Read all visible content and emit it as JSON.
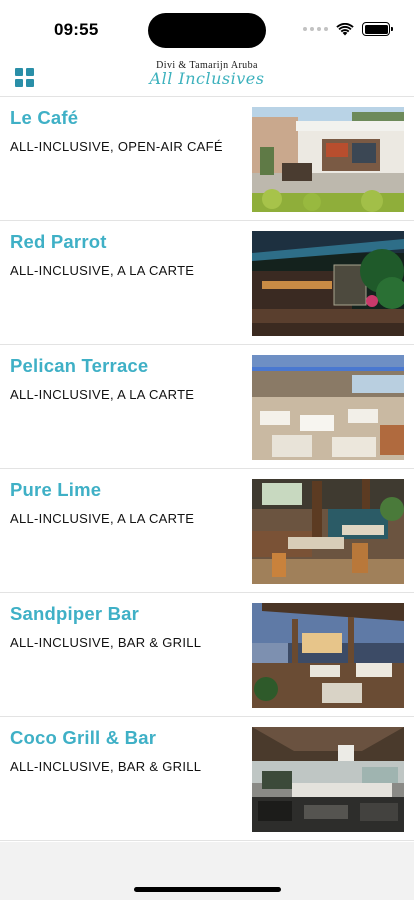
{
  "status_bar": {
    "time": "09:55"
  },
  "header": {
    "logo_top": "Divi & Tamarijn Aruba",
    "logo_script": "All Inclusives",
    "menu_icon": "grid-icon",
    "accent_color": "#3fb0c6"
  },
  "restaurants": [
    {
      "name": "Le Café",
      "description": "ALL-INCLUSIVE, OPEN-AIR CAFÉ"
    },
    {
      "name": "Red Parrot",
      "description": "ALL-INCLUSIVE, A LA CARTE"
    },
    {
      "name": "Pelican Terrace",
      "description": "ALL-INCLUSIVE, A LA CARTE"
    },
    {
      "name": "Pure Lime",
      "description": "ALL-INCLUSIVE, A LA CARTE"
    },
    {
      "name": "Sandpiper Bar",
      "description": "ALL-INCLUSIVE, BAR & GRILL"
    },
    {
      "name": "Coco Grill & Bar",
      "description": "ALL-INCLUSIVE, BAR & GRILL"
    }
  ]
}
